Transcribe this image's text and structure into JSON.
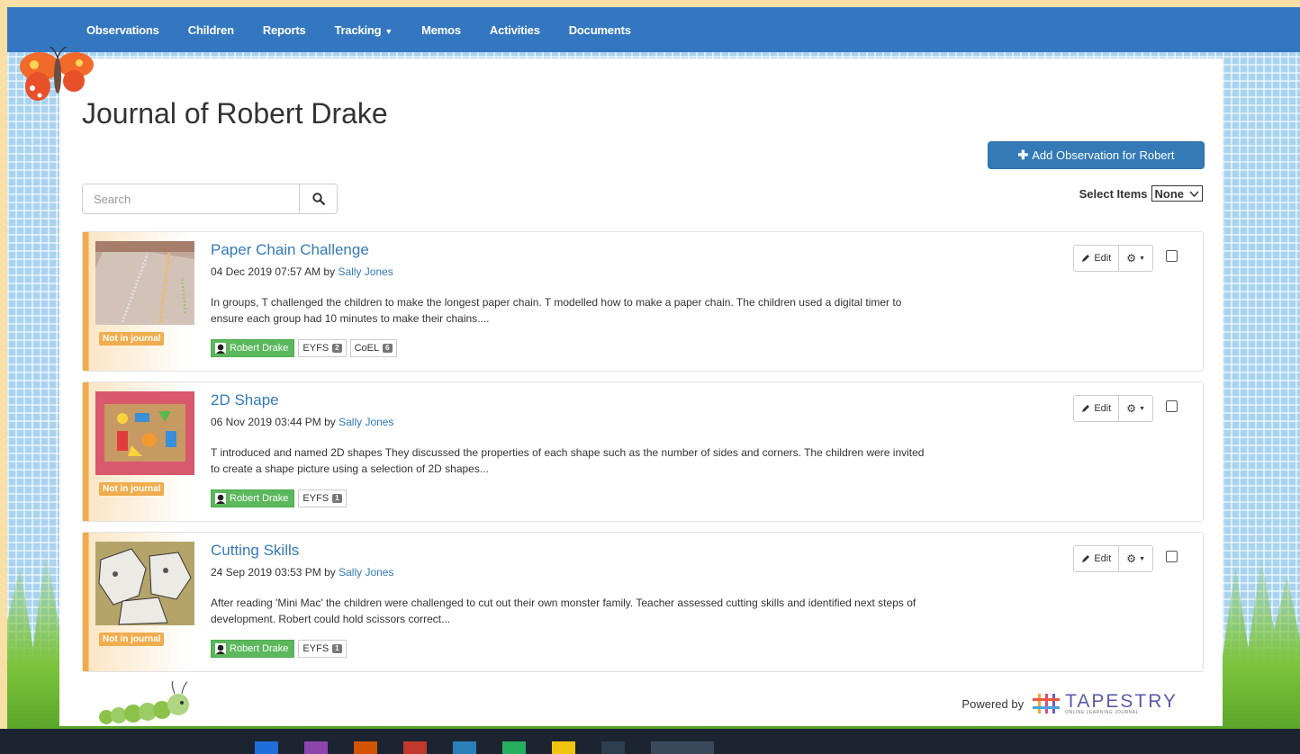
{
  "nav": {
    "items": [
      "Observations",
      "Children",
      "Reports",
      "Tracking",
      "Memos",
      "Activities",
      "Documents"
    ]
  },
  "page": {
    "title": "Journal of Robert Drake",
    "add_button_label": "Add Observation for Robert",
    "search_placeholder": "Search",
    "select_items_label": "Select Items",
    "select_items_value": "None"
  },
  "observations": [
    {
      "title": "Paper Chain Challenge",
      "date": "04 Dec 2019 07:57 AM by ",
      "author": "Sally Jones",
      "text": "In groups, T challenged the children to make the longest paper chain. T modelled how to make a paper chain. The children used a digital timer to ensure each group had 10 minutes to make their chains....",
      "status": "Not in journal",
      "child_tag": "Robert Drake",
      "tags": [
        {
          "label": "EYFS",
          "count": "2"
        },
        {
          "label": "CoEL",
          "count": "6"
        }
      ]
    },
    {
      "title": "2D Shape",
      "date": "06 Nov 2019 03:44 PM by ",
      "author": "Sally Jones",
      "text": "T introduced and named 2D shapes They discussed the properties of each shape such as the number of sides and corners. The children were invited to create a shape picture using a selection of 2D shapes...",
      "status": "Not in journal",
      "child_tag": "Robert Drake",
      "tags": [
        {
          "label": "EYFS",
          "count": "1"
        }
      ]
    },
    {
      "title": "Cutting Skills",
      "date": "24 Sep 2019 03:53 PM by ",
      "author": "Sally Jones",
      "text": "After reading 'Mini Mac' the children were challenged to cut out their own monster family. Teacher assessed cutting skills and identified next steps of development. Robert could hold scissors correct...",
      "status": "Not in journal",
      "child_tag": "Robert Drake",
      "tags": [
        {
          "label": "EYFS",
          "count": "1"
        }
      ]
    }
  ],
  "card_actions": {
    "edit_label": "Edit"
  },
  "footer": {
    "powered_by": "Powered by",
    "brand": "TAPESTRY",
    "brand_tagline": "ONLINE LEARNING JOURNAL"
  },
  "colors": {
    "navbar": "#3477c1",
    "link": "#337ab7",
    "primary_button": "#337ab7",
    "status_warning": "#f0ad4e",
    "child_tag": "#5cb85c"
  }
}
